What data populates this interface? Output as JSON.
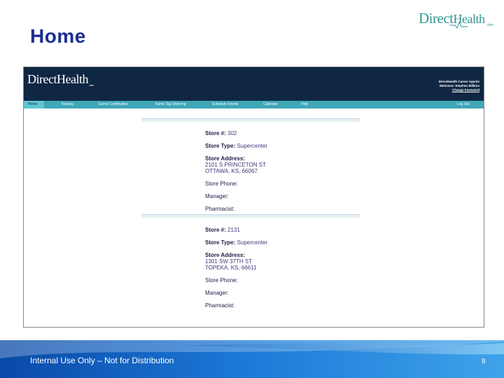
{
  "slide": {
    "title": "Home",
    "brand": {
      "name_a": "Direct",
      "name_b": "Health",
      "sub": ".com"
    },
    "footer_note": "Internal Use Only – Not for Distribution",
    "page_number": "8"
  },
  "app": {
    "logo": {
      "name_a": "Direct",
      "name_b": "Health",
      "sub": ".com"
    },
    "user_panel": {
      "line1": "DirectHealth Career Agents",
      "line2": "Welcome: Stephen Wilkins",
      "link": "Change Password"
    },
    "nav": [
      {
        "label": "Home",
        "active": true
      },
      {
        "label": "Training"
      },
      {
        "label": "Carrier Certification"
      },
      {
        "label": "Name Tag Ordering"
      },
      {
        "label": "Schedule Events"
      },
      {
        "label": "Calendar"
      },
      {
        "label": "Help"
      },
      {
        "label": "Log Out"
      }
    ],
    "stores": [
      {
        "number_label": "Store #:",
        "number": "302",
        "type_label": "Store Type:",
        "type": "Supercenter",
        "address_label": "Store Address:",
        "address_line1": "2101 S PRINCETON ST",
        "address_line2": "OTTAWA, KS, 66067",
        "phone_label": "Store Phone:",
        "manager_label": "Manager:",
        "pharmacist_label": "Pharmacist:"
      },
      {
        "number_label": "Store #:",
        "number": "2131",
        "type_label": "Store Type:",
        "type": "Supercenter",
        "address_label": "Store Address:",
        "address_line1": "1301 SW 37TH ST",
        "address_line2": "TOPEKA, KS, 66611",
        "phone_label": "Store Phone:",
        "manager_label": "Manager:",
        "pharmacist_label": "Pharmacist:"
      }
    ]
  },
  "colors": {
    "title": "#1c2f8f",
    "brand": "#2f9a8e",
    "header": "#0f2743",
    "nav": "#3fa7b8",
    "footer": "#1a6fd0"
  }
}
